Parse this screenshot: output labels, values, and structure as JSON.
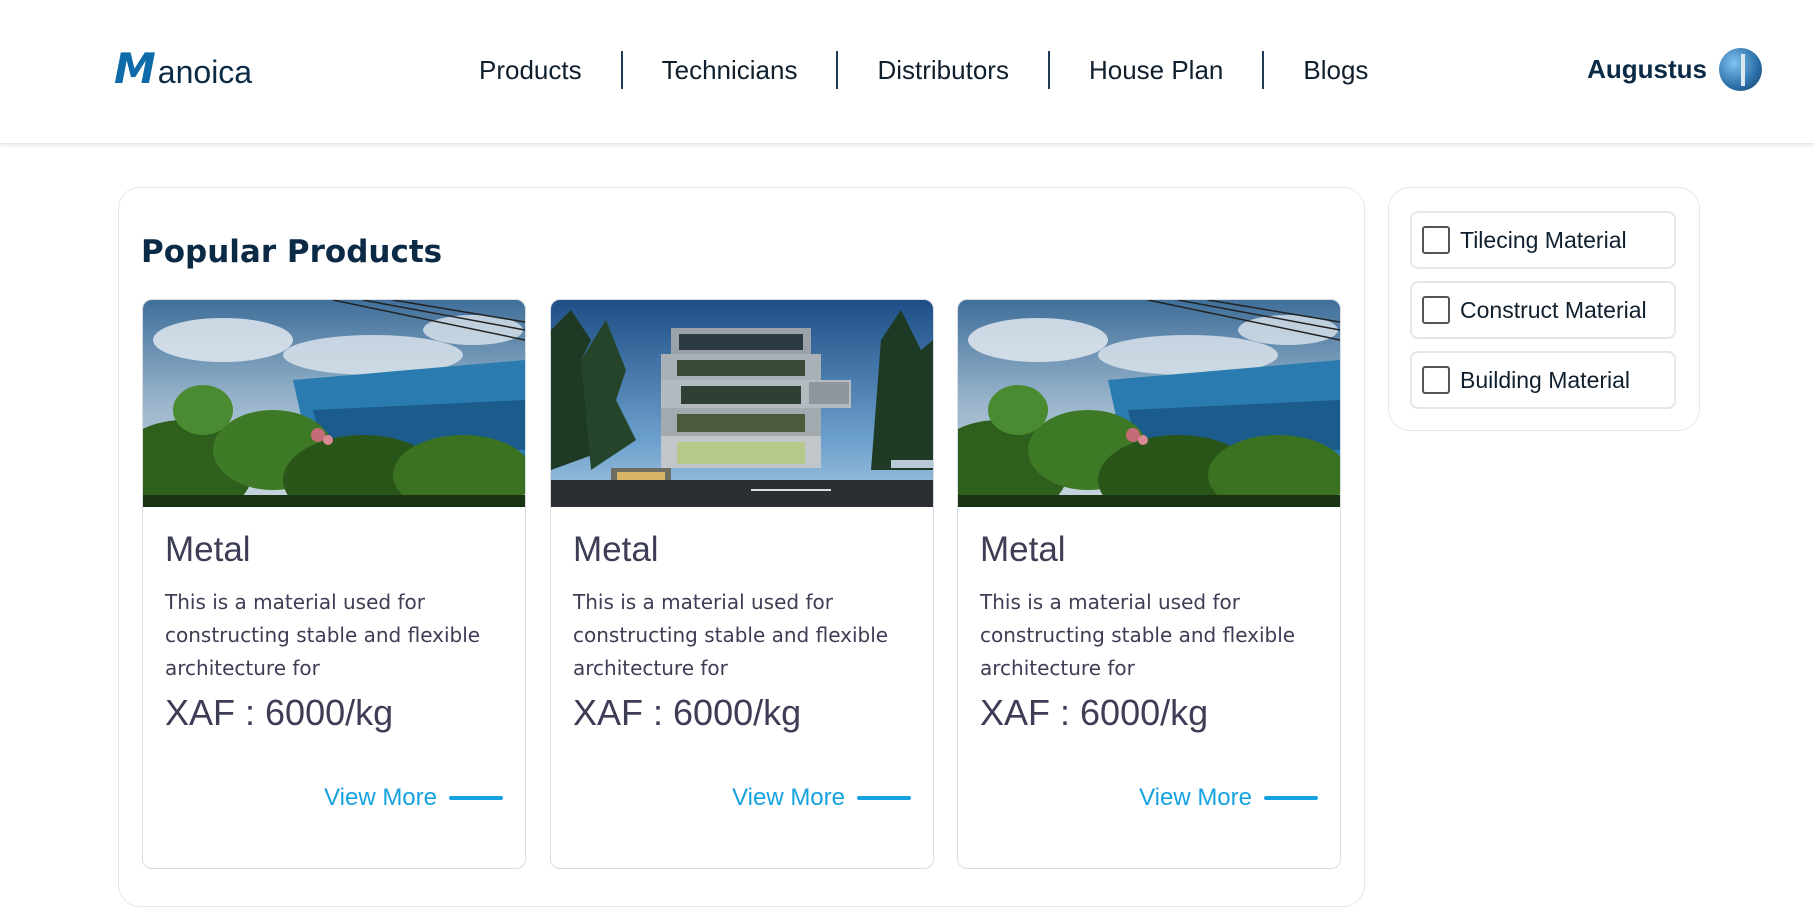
{
  "header": {
    "logo_initial": "M",
    "logo_rest": "anoica",
    "nav": [
      {
        "label": "Products"
      },
      {
        "label": "Technicians"
      },
      {
        "label": "Distributors"
      },
      {
        "label": "House Plan"
      },
      {
        "label": "Blogs"
      }
    ],
    "user_name": "Augustus"
  },
  "main": {
    "section_title": "Popular Products",
    "products": [
      {
        "title": "Metal",
        "description": "This is a material used for constructing stable and flexible architecture for",
        "price": "XAF : 6000/kg",
        "cta": "View More",
        "image": "garden-foliage-photo"
      },
      {
        "title": "Metal",
        "description": "This is a material used for constructing stable and flexible architecture for",
        "price": "XAF : 6000/kg",
        "cta": "View More",
        "image": "modern-building-photo"
      },
      {
        "title": "Metal",
        "description": "This is a material used for constructing stable and flexible architecture for",
        "price": "XAF : 6000/kg",
        "cta": "View More",
        "image": "garden-foliage-photo"
      }
    ]
  },
  "filters": [
    {
      "label": "Tilecing Material",
      "checked": false
    },
    {
      "label": "Construct Material",
      "checked": false
    },
    {
      "label": "Building Material",
      "checked": false
    }
  ],
  "colors": {
    "brand_dark": "#0b2a45",
    "brand_blue": "#0e6aa8",
    "accent": "#16a2e0",
    "card_text": "#3d3d55"
  }
}
